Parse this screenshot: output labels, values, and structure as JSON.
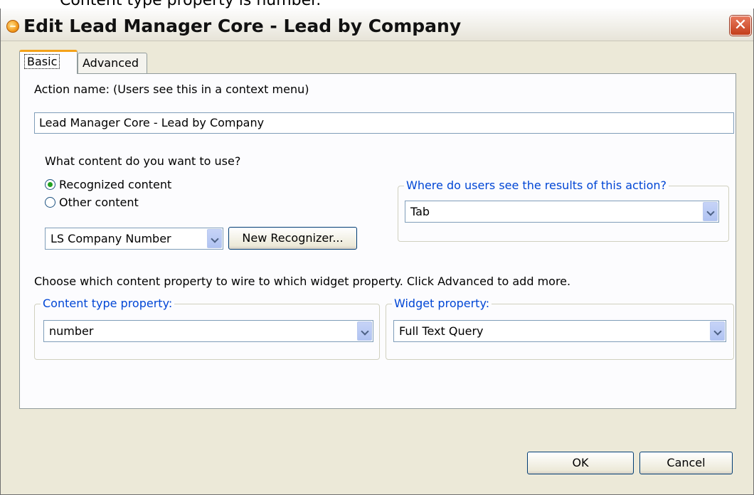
{
  "doc_caption": "Content type property is number.",
  "dialog": {
    "title": "Edit Lead Manager Core - Lead by Company",
    "close_label": "✕"
  },
  "tabs": [
    {
      "label": "Basic",
      "active": true
    },
    {
      "label": "Advanced",
      "active": false
    }
  ],
  "basic": {
    "action_name_label": "Action name: (Users see this in a context menu)",
    "action_name_value": "Lead Manager Core - Lead by Company",
    "content_question": "What content do you want to use?",
    "radio_recognized": "Recognized content",
    "radio_other": "Other content",
    "recognizer_value": "LS Company Number",
    "new_recognizer_button": "New Recognizer...",
    "results_group_label": "Where do users see the results of this action?",
    "results_value": "Tab",
    "wire_instructions": "Choose which content property to wire to which widget property. Click Advanced to add more.",
    "content_type_group_label": "Content type property:",
    "content_type_value": "number",
    "widget_group_label": "Widget property:",
    "widget_value": "Full Text Query"
  },
  "footer": {
    "ok_label": "OK",
    "cancel_label": "Cancel"
  },
  "colors": {
    "group_label": "#0046d5",
    "tab_highlight": "#f4a21a",
    "close_button": "#c33d1a",
    "dialog_background": "#ece9d8"
  }
}
